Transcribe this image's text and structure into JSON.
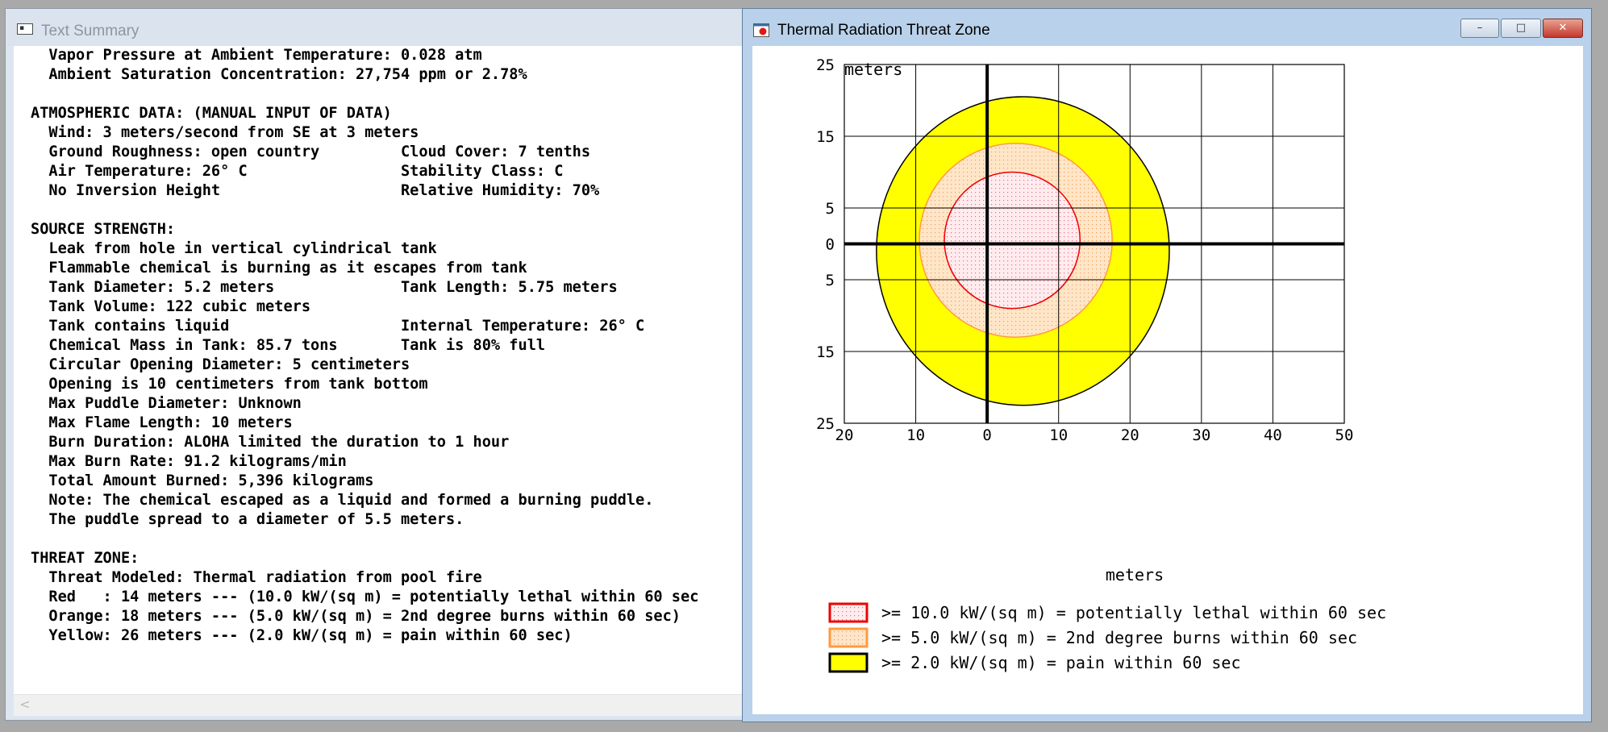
{
  "text_summary": {
    "title": "Text Summary",
    "lines": [
      "  Vapor Pressure at Ambient Temperature: 0.028 atm",
      "  Ambient Saturation Concentration: 27,754 ppm or 2.78%",
      "",
      "ATMOSPHERIC DATA: (MANUAL INPUT OF DATA)",
      "  Wind: 3 meters/second from SE at 3 meters",
      "  Ground Roughness: open country         Cloud Cover: 7 tenths",
      "  Air Temperature: 26° C                 Stability Class: C",
      "  No Inversion Height                    Relative Humidity: 70%",
      "",
      "SOURCE STRENGTH:",
      "  Leak from hole in vertical cylindrical tank",
      "  Flammable chemical is burning as it escapes from tank",
      "  Tank Diameter: 5.2 meters              Tank Length: 5.75 meters",
      "  Tank Volume: 122 cubic meters",
      "  Tank contains liquid                   Internal Temperature: 26° C",
      "  Chemical Mass in Tank: 85.7 tons       Tank is 80% full",
      "  Circular Opening Diameter: 5 centimeters",
      "  Opening is 10 centimeters from tank bottom",
      "  Max Puddle Diameter: Unknown",
      "  Max Flame Length: 10 meters",
      "  Burn Duration: ALOHA limited the duration to 1 hour",
      "  Max Burn Rate: 91.2 kilograms/min",
      "  Total Amount Burned: 5,396 kilograms",
      "  Note: The chemical escaped as a liquid and formed a burning puddle.",
      "  The puddle spread to a diameter of 5.5 meters.",
      "",
      "THREAT ZONE:",
      "  Threat Modeled: Thermal radiation from pool fire",
      "  Red   : 14 meters --- (10.0 kW/(sq m) = potentially lethal within 60 sec",
      "  Orange: 18 meters --- (5.0 kW/(sq m) = 2nd degree burns within 60 sec)",
      "  Yellow: 26 meters --- (2.0 kW/(sq m) = pain within 60 sec)"
    ],
    "scroll_left_glyph": "<"
  },
  "threat_window": {
    "title": "Thermal Radiation Threat Zone",
    "min_glyph": "–",
    "max_glyph": "□",
    "close_glyph": "✕"
  },
  "chart_data": {
    "type": "threat-zone-plot",
    "xlabel": "meters",
    "ylabel": "meters",
    "xlim": [
      -20,
      50
    ],
    "ylim": [
      -25,
      25
    ],
    "x_ticks": [
      -20,
      -10,
      0,
      10,
      20,
      30,
      40,
      50
    ],
    "x_tick_labels": [
      "20",
      "10",
      "0",
      "10",
      "20",
      "30",
      "40",
      "50"
    ],
    "y_ticks": [
      25,
      15,
      5,
      0,
      -5,
      -15,
      -25
    ],
    "y_tick_labels": [
      "25",
      "15",
      "5",
      "0",
      "5",
      "15",
      "25"
    ],
    "grid": true,
    "zones": [
      {
        "name": "yellow",
        "threshold": ">= 2.0 kW/(sq m) = pain within 60 sec",
        "radius_m": 26,
        "center": [
          5,
          -1
        ],
        "rx": 20.5,
        "ry": 21.5,
        "fill": "#ffff00",
        "stroke": "#000000",
        "pattern": "solid"
      },
      {
        "name": "orange",
        "threshold": ">= 5.0 kW/(sq m) = 2nd degree burns within 60 sec",
        "radius_m": 18,
        "center": [
          4,
          0.5
        ],
        "rx": 13.5,
        "ry": 13.5,
        "fill": "#ffe3c4",
        "stroke": "#ff9a40",
        "pattern": "dots-orange"
      },
      {
        "name": "red",
        "threshold": ">= 10.0 kW/(sq m) = potentially lethal within 60 sec",
        "radius_m": 14,
        "center": [
          3.5,
          0.5
        ],
        "rx": 9.5,
        "ry": 9.5,
        "fill": "#ffe8ec",
        "stroke": "#ee0000",
        "pattern": "dots-red"
      }
    ],
    "legend": [
      {
        "text": ">= 10.0 kW/(sq m) = potentially lethal within 60 sec",
        "fill": "#ffe8ec",
        "stroke": "#ee0000"
      },
      {
        "text": ">= 5.0 kW/(sq m) = 2nd degree burns within 60 sec",
        "fill": "#ffe3c4",
        "stroke": "#ff9a40"
      },
      {
        "text": ">= 2.0 kW/(sq m) = pain within 60 sec",
        "fill": "#ffff00",
        "stroke": "#000000"
      }
    ]
  }
}
